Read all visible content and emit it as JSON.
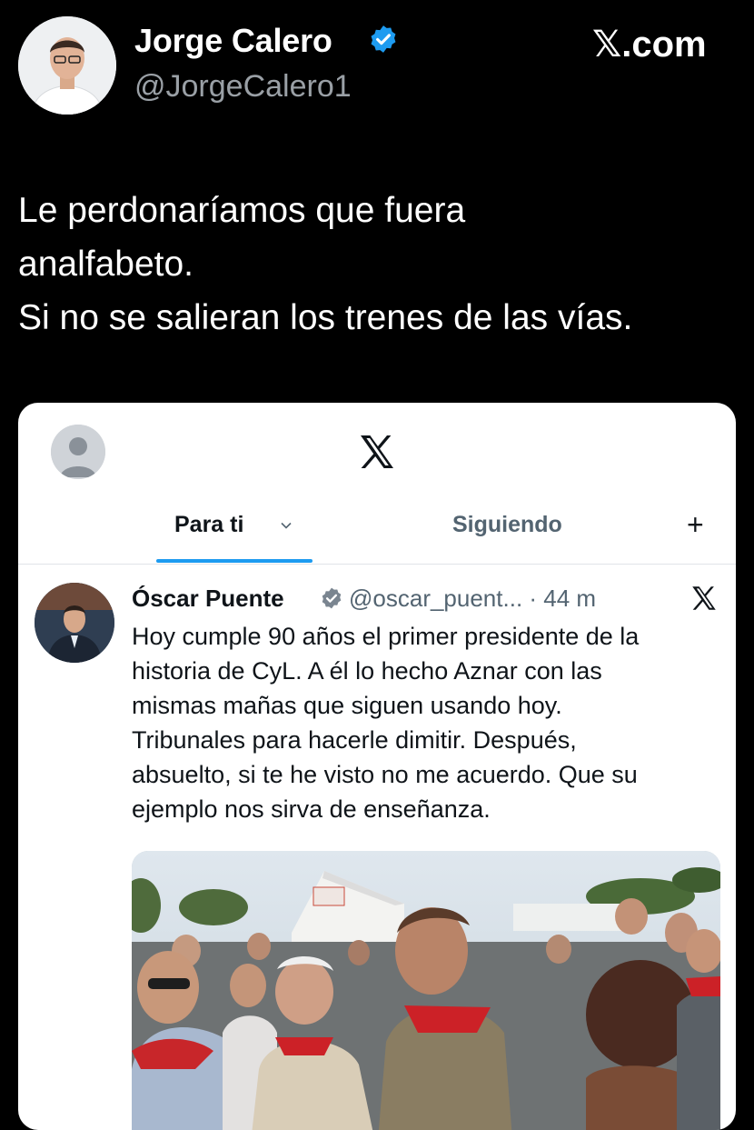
{
  "outer_tweet": {
    "author_name": "Jorge Calero",
    "author_handle": "@JorgeCalero1",
    "site": "𝕏.com",
    "text_lines": [
      "Le perdonaríamos que fuera",
      "analfabeto.",
      "Si no se salieran los trenes de las vías."
    ],
    "verified_color": "#1d9bf0"
  },
  "embedded": {
    "tabs": {
      "for_you": "Para ti",
      "following": "Siguiendo",
      "plus": "+"
    },
    "post": {
      "author_name": "Óscar Puente",
      "handle_time": "@oscar_puent... · 44 m",
      "body_lines": [
        "Hoy cumple 90 años el primer presidente de la",
        "historia de CyL. A él lo hecho Aznar con las",
        "mismas mañas que siguen usando hoy.",
        "Tribunales para hacerle dimitir. Después,",
        "absuelto, si te he visto no me acuerdo. Que su",
        "ejemplo nos sirva de enseñanza."
      ]
    },
    "accent_color": "#1d9bf0"
  }
}
